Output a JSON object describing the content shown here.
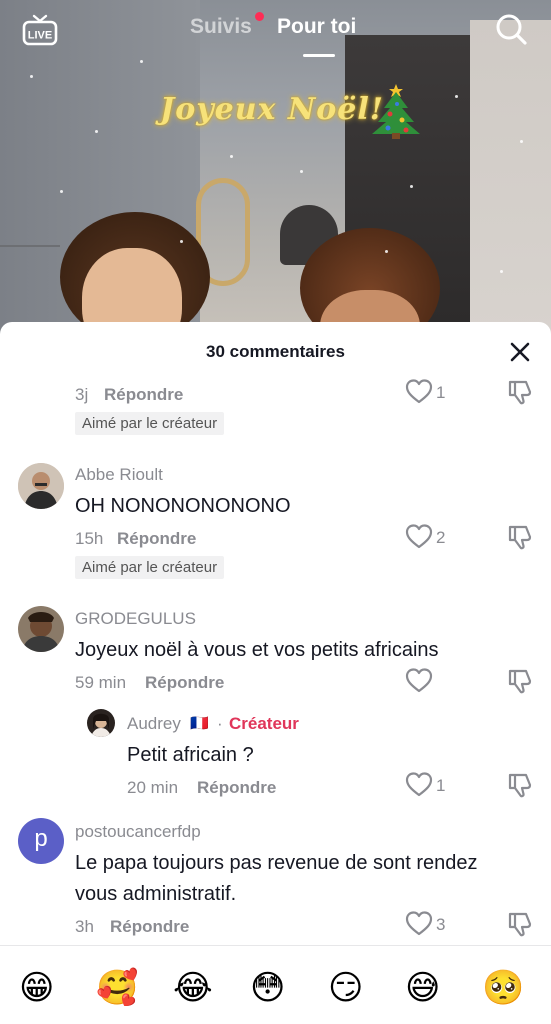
{
  "nav": {
    "live_label": "LIVE",
    "tab_following": "Suivis",
    "tab_foryou": "Pour toi"
  },
  "video": {
    "sticker_text": "Joyeux Noël!"
  },
  "sheet": {
    "title": "30 commentaires",
    "comments": [
      {
        "time": "3j",
        "reply": "Répondre",
        "likes": "1",
        "badge": "Aimé par le créateur"
      },
      {
        "username": "Abbe Rioult",
        "text": "OH NONONONONONO",
        "time": "15h",
        "reply": "Répondre",
        "likes": "2",
        "badge": "Aimé par le créateur"
      },
      {
        "username": "GRODEGULUS",
        "text": "Joyeux noël à vous et vos petits africains",
        "time": "59 min",
        "reply": "Répondre"
      },
      {
        "username": "Audrey",
        "flag": "🇫🇷",
        "separator": "·",
        "creator_label": "Créateur",
        "text": "Petit africain ?",
        "time": "20 min",
        "reply": "Répondre",
        "likes": "1"
      },
      {
        "username": "postoucancerfdp",
        "avatar_letter": "p",
        "text_line1": "Le papa toujours pas revenue de sont rendez",
        "text_line2": "vous administratif.",
        "time": "3h",
        "reply": "Répondre",
        "likes": "3"
      }
    ]
  },
  "emoji_bar": [
    "😁",
    "🥰",
    "😂",
    "😳",
    "😏",
    "😅",
    "🥺"
  ],
  "colors": {
    "accent": "#fe2c55",
    "creator_label": "#e0365a",
    "avatar_p": "#5b5fc7",
    "text_primary": "#161823",
    "text_secondary": "#8a8b91"
  }
}
